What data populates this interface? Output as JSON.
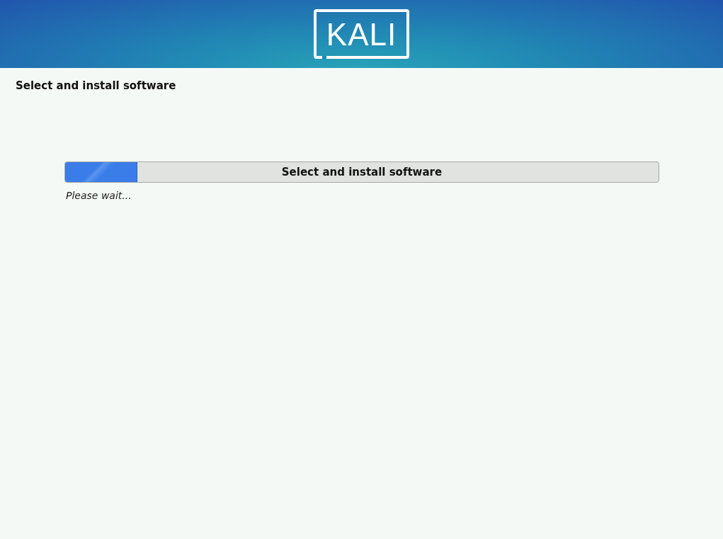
{
  "header": {
    "logo": "KALI"
  },
  "page_title": "Select and install software",
  "progress": {
    "label": "Select and install software",
    "level": 0.12,
    "status": "Please wait..."
  }
}
